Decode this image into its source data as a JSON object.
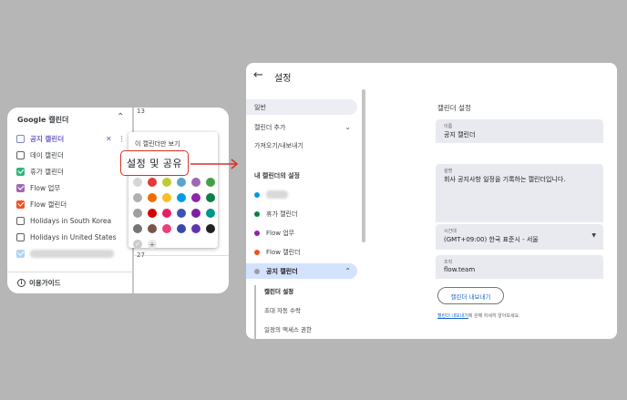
{
  "calendar_panel": {
    "header": "Google 캘린더",
    "items": [
      {
        "label": "공지 캘린더",
        "checked": false,
        "color": "#7986cb",
        "active": true
      },
      {
        "label": "데이 캘린더",
        "checked": false,
        "color": "#616161"
      },
      {
        "label": "휴가 캘린더",
        "checked": true,
        "color": "#33b679"
      },
      {
        "label": "Flow 업무",
        "checked": true,
        "color": "#9e69af"
      },
      {
        "label": "Flow 캘린더",
        "checked": true,
        "color": "#f4511e"
      },
      {
        "label": "Holidays in South Korea",
        "checked": false,
        "color": "#616161"
      },
      {
        "label": "Holidays in United States",
        "checked": false,
        "color": "#616161"
      },
      {
        "label": "",
        "checked": true,
        "color": "#aed6f1",
        "blurred": true
      }
    ],
    "row_close": "✕",
    "row_more": "⋮",
    "guide": "이용가이드",
    "day_top": "13",
    "day_bottom": "27"
  },
  "popup": {
    "show_only": "이 캘린더만 보기",
    "share_label": "설정 및 공유",
    "swatches": [
      [
        "#d6d6d6",
        "#e53935",
        "#c0ca33",
        "#5ba4cf",
        "#9e69af",
        "#43a047"
      ],
      [
        "#b0b0b0",
        "#ef6c00",
        "#f6bf26",
        "#039be5",
        "#8e24aa",
        "#0b8043"
      ],
      [
        "#9e9e9e",
        "#d50000",
        "#e91e63",
        "#3f51b5",
        "#7b1fa2",
        "#009688"
      ],
      [
        "#757575",
        "#795548",
        "#ec407a",
        "#3949ab",
        "#5e35b1",
        "#212121"
      ]
    ],
    "selected_mark": "✓",
    "add_mark": "+"
  },
  "settings": {
    "title": "설정",
    "back_icon": "←",
    "nav": {
      "general": "일반",
      "add_calendar": "캘린더 추가",
      "import_export": "가져오기/내보내기",
      "my_calendars_header": "내 캘린더의 설정",
      "calendars": [
        {
          "label": "",
          "color": "#039be5",
          "blurred": true
        },
        {
          "label": "휴가 캘린더",
          "color": "#0b8043"
        },
        {
          "label": "Flow 업무",
          "color": "#8e24aa"
        },
        {
          "label": "Flow 캘린더",
          "color": "#f4511e"
        },
        {
          "label": "공지 캘린더",
          "color": "#9e9e9e"
        }
      ],
      "sub_items": [
        "캘린더 설정",
        "초대 자동 수락",
        "일정의 액세스 권한"
      ]
    },
    "content": {
      "section_title": "캘린더 설정",
      "name_label": "이름",
      "name_value": "공지 캘린더",
      "desc_label": "설명",
      "desc_value": "회사 공지사항 일정을 기록하는 캘린더입니다.",
      "tz_label": "시간대",
      "tz_value": "(GMT+09:00) 한국 표준시 - 서울",
      "org_label": "조직",
      "org_value": "flow.team",
      "export_button": "캘린더 내보내기",
      "footer_link": "캘린더 내보내기",
      "footer_text": "에 관해 자세히 알아보세요."
    }
  },
  "colors": {
    "accent": "#1967d2",
    "highlight": "#d93025"
  }
}
